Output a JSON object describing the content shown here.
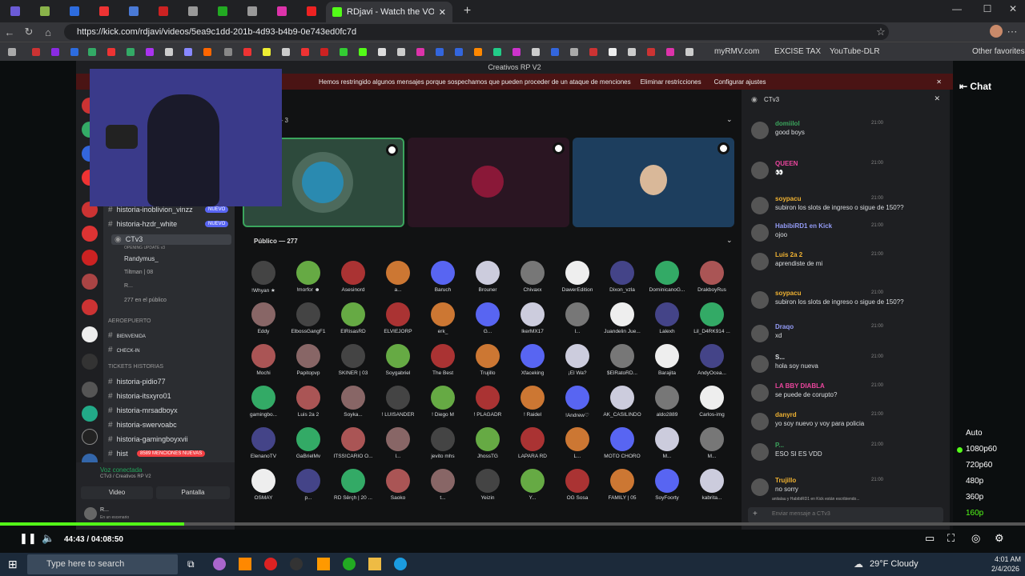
{
  "browser": {
    "active_tab": "RDjavi - Watch the VOD on Ki",
    "url": "https://kick.com/rdjavi/videos/5ea9c1dd-201b-4d93-b4b9-0e743ed0fc7d",
    "bookmarks": [
      "myRMV.com",
      "EXCISE TAX",
      "YouTube-DLR",
      "Other favorites"
    ]
  },
  "discord": {
    "window_title": "Creativos RP V2",
    "warning": "Hemos restringido algunos mensajes porque sospechamos que pueden proceder de un ataque de menciones",
    "warning_action1": "Eliminar restricciones",
    "warning_action2": "Configurar ajustes",
    "stage_header": "s — 3",
    "public_header": "Público — 277",
    "channels": [
      {
        "name": "historia-inoblivion_vinzz",
        "badge": "NUEVO"
      },
      {
        "name": "historia-hzdr_white",
        "badge": "NUEVO"
      },
      {
        "name": "CTv3",
        "badge": ""
      }
    ],
    "ctv_sub": "OPENING UPDATE v3",
    "voice_users": [
      "Randymus_",
      "Tiltman | 08",
      "R..."
    ],
    "public_count": "277 en el público",
    "cat1": "AEROEPUERTO",
    "cat1_items": [
      "BIENVENIDA",
      "CHECK-IN"
    ],
    "cat2": "TICKETS HISTORIAS",
    "hist_channels": [
      "historia-pidio77",
      "historia-itsxyro01",
      "historia-mrsadboyx",
      "historia-swervoabc",
      "historia-gamingboyxvii",
      "hist"
    ],
    "mentions_badge": "8589 MENCIONES NUEVAS",
    "voice_connected": "Voz conectada",
    "voice_sub": "CTv3 / Creativos RP V2",
    "video_btn": "Video",
    "screen_btn": "Pantalla",
    "user_name": "R...",
    "user_sub": "En un escenario",
    "chat_header": "CTv3",
    "chat_input": "Enviar mensaje a CTv3",
    "typing": "anitalau y HabibiRD1 en Kick están escribiendo...",
    "participants": [
      "!Whyan ★",
      "!morfor ☻",
      "Asesinord",
      "a...",
      "Baruch",
      "Brouner",
      "Chivaxx",
      "DawerEdition",
      "Dixon_vzla",
      "DominicanoG...",
      "DrakboyRus",
      "Eddy",
      "ElbossGangF1",
      "ElRisasRD",
      "ELVIEJORP",
      "erk_",
      "G...",
      "IkerMX17",
      "l...",
      "Juandelin Jue...",
      "Lalexh",
      "Lil_D4RK914 ...",
      "Mochi",
      "Papitopvp",
      "SKINER | 03",
      "Soygabriel",
      "The Best",
      "Trujillo",
      "Xfaceking",
      "¡El Wa?",
      "$ElRatoRD...",
      "Barajita",
      "AndyOcea...",
      "gamingbo...",
      "Luis 2a 2",
      "Soyka...",
      "! LUISANDER",
      "! Diego M",
      "! PLAGADR",
      "! Raidel",
      "!Andrew♡",
      "AK_CASILINDO",
      "aldo2889",
      "Carlos-img",
      "ElenanoTV",
      "GaBrielMv",
      "ITSS!CARIO O...",
      "l...",
      "jevito mhs",
      "JhossTG",
      "LAPARA RD",
      "L...",
      "MOTO CHORO",
      "M...",
      "M...",
      "OSMAY",
      "p...",
      "RD Šêrçh | 20 ...",
      "Saoko",
      "t...",
      "Yeizin",
      "Y...",
      "OG Sosa",
      "FAMILY | 05",
      "SoyFoorty",
      "kabrita..."
    ],
    "messages": [
      {
        "name": "domiilol",
        "time": "21:00",
        "text": "good boys",
        "color": "#3ba55d"
      },
      {
        "name": "QUEEN",
        "time": "21:00",
        "text": "👀",
        "color": "#eb459e"
      },
      {
        "name": "soypacu",
        "time": "21:00",
        "text": "subiron los slots de ingreso o sigue de 150??",
        "color": "#f0b232"
      },
      {
        "name": "HabibiRD1 en Kick",
        "time": "21:00",
        "text": "ojoo",
        "color": "#949cf7"
      },
      {
        "name": "Luis 2a 2",
        "time": "21:00",
        "text": "aprendiste de mi",
        "color": "#f0b232"
      },
      {
        "name": "soypacu",
        "time": "21:00",
        "text": "subiron los slots de ingreso o sigue de 150??",
        "color": "#f0b232"
      },
      {
        "name": "Draqo",
        "time": "21:00",
        "text": "xd",
        "color": "#949cf7"
      },
      {
        "name": "S...",
        "time": "21:00",
        "text": "hola soy nueva",
        "color": "#dbdee1"
      },
      {
        "name": "LA BBY DIABLA",
        "time": "21:00",
        "text": "se puede de corupto?",
        "color": "#eb459e"
      },
      {
        "name": "danyrd",
        "time": "21:00",
        "text": "yo soy nuevo y voy para policia",
        "color": "#f0b232"
      },
      {
        "name": "P...",
        "time": "21:00",
        "text": "ESO SI ES VDD",
        "color": "#3ba55d"
      },
      {
        "name": "Trujillo",
        "time": "21:00",
        "text": "no sorry",
        "color": "#f0b232"
      }
    ]
  },
  "player": {
    "chat_label": "Chat",
    "time": "44:43 / 04:08:50",
    "progress": 0.18,
    "qualities": [
      "Auto",
      "1080p60",
      "720p60",
      "480p",
      "360p",
      "160p"
    ],
    "selected_quality": "1080p60"
  },
  "taskbar": {
    "search": "Type here to search",
    "weather": "29°F  Cloudy",
    "time": "4:01 AM",
    "date": "2/4/2026"
  }
}
